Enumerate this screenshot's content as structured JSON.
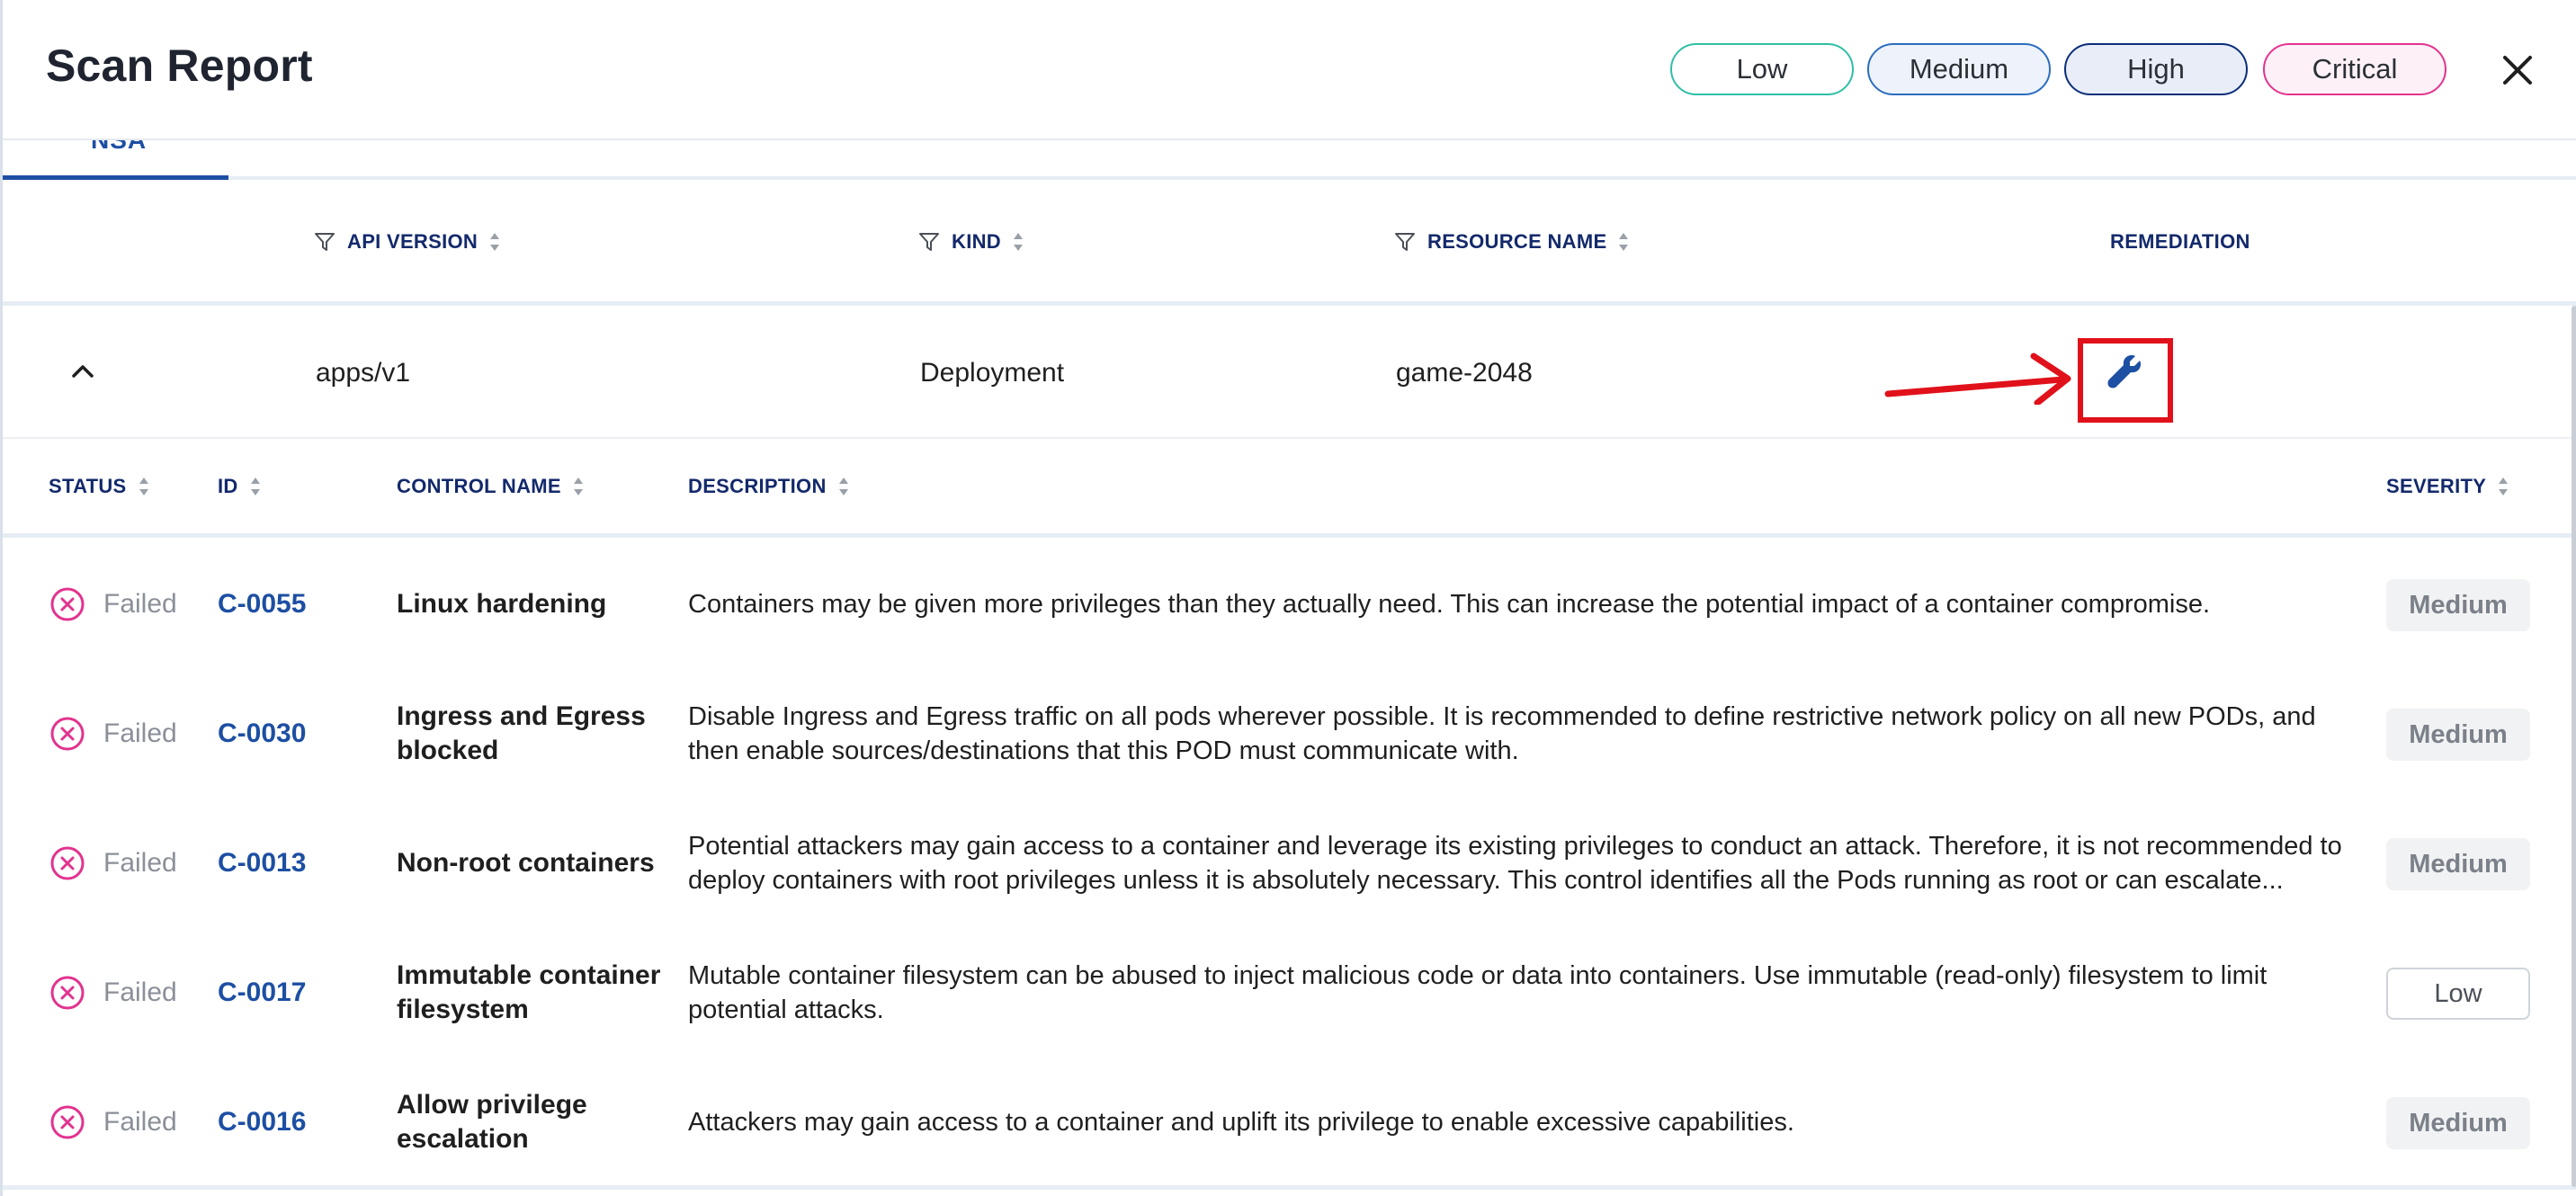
{
  "header": {
    "title": "Scan Report",
    "filters": [
      "Low",
      "Medium",
      "High",
      "Critical"
    ],
    "close_icon": "close-icon"
  },
  "tabs": {
    "active_label": "NSA"
  },
  "resource_table": {
    "columns": {
      "api_version": "API VERSION",
      "kind": "KIND",
      "resource_name": "RESOURCE NAME",
      "remediation": "REMEDIATION"
    },
    "row": {
      "api_version": "apps/v1",
      "kind": "Deployment",
      "resource_name": "game-2048",
      "remediation_icon": "wrench-icon"
    }
  },
  "controls_table": {
    "columns": {
      "status": "STATUS",
      "id": "ID",
      "control_name": "CONTROL NAME",
      "description": "DESCRIPTION",
      "severity": "SEVERITY"
    },
    "rows": [
      {
        "status": "Failed",
        "id": "C-0055",
        "name": "Linux hardening",
        "description": "Containers may be given more privileges than they actually need. This can increase the potential impact of a container compromise.",
        "severity": "Medium"
      },
      {
        "status": "Failed",
        "id": "C-0030",
        "name": "Ingress and Egress blocked",
        "description": "Disable Ingress and Egress traffic on all pods wherever possible. It is recommended to define restrictive network policy on all new PODs, and then enable sources/destinations that this POD must communicate with.",
        "severity": "Medium"
      },
      {
        "status": "Failed",
        "id": "C-0013",
        "name": "Non-root containers",
        "description": "Potential attackers may gain access to a container and leverage its existing privileges to conduct an attack. Therefore, it is not recommended to deploy containers with root privileges unless it is absolutely necessary. This control identifies all the Pods running as root or can escalate...",
        "severity": "Medium"
      },
      {
        "status": "Failed",
        "id": "C-0017",
        "name": "Immutable container filesystem",
        "description": "Mutable container filesystem can be abused to inject malicious code or data into containers. Use immutable (read-only) filesystem to limit potential attacks.",
        "severity": "Low"
      },
      {
        "status": "Failed",
        "id": "C-0016",
        "name": "Allow privilege escalation",
        "description": "Attackers may gain access to a container and uplift its privilege to enable excessive capabilities.",
        "severity": "Medium"
      }
    ]
  },
  "colors": {
    "accent": "#1d4fa3",
    "header_text": "#13296b",
    "failed_icon": "#e2338f",
    "annotation": "#e0111a"
  }
}
